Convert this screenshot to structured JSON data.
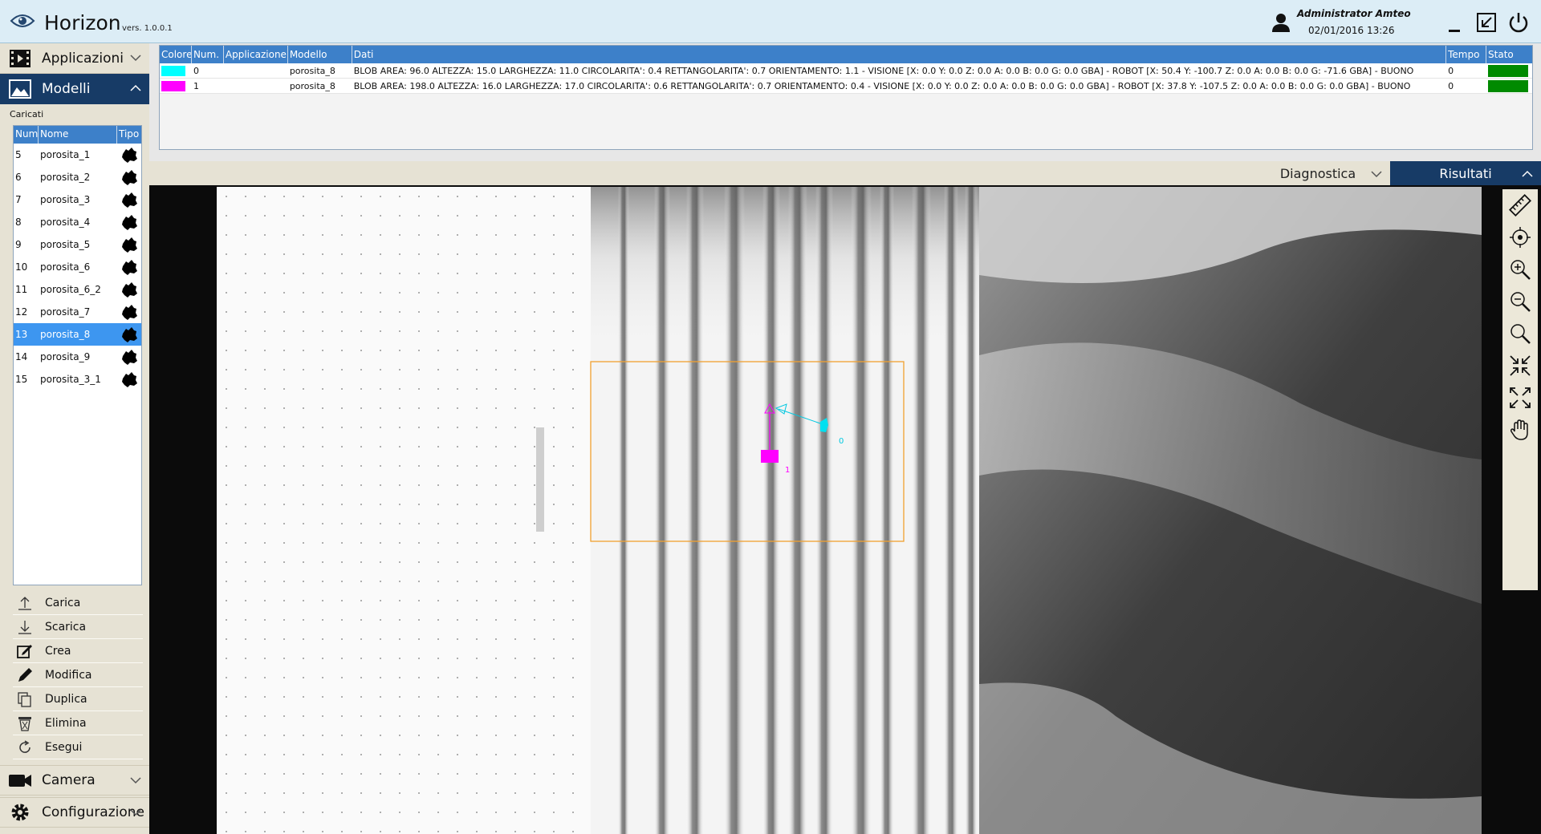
{
  "app": {
    "title": "Horizon",
    "version": "vers. 1.0.0.1"
  },
  "user": {
    "name": "Administrator Amteo",
    "datetime": "02/01/2016 13:26"
  },
  "sidebar": {
    "sections": {
      "applicazioni": "Applicazioni",
      "modelli": "Modelli",
      "camera": "Camera",
      "configurazione": "Configurazione"
    },
    "loaded_label": "Caricati",
    "list_headers": {
      "num": "Num",
      "name": "Nome",
      "type": "Tipo"
    },
    "models": [
      {
        "num": "5",
        "name": "porosita_1"
      },
      {
        "num": "6",
        "name": "porosita_2"
      },
      {
        "num": "7",
        "name": "porosita_3"
      },
      {
        "num": "8",
        "name": "porosita_4"
      },
      {
        "num": "9",
        "name": "porosita_5"
      },
      {
        "num": "10",
        "name": "porosita_6"
      },
      {
        "num": "11",
        "name": "porosita_6_2"
      },
      {
        "num": "12",
        "name": "porosita_7"
      },
      {
        "num": "13",
        "name": "porosita_8"
      },
      {
        "num": "14",
        "name": "porosita_9"
      },
      {
        "num": "15",
        "name": "porosita_3_1"
      }
    ],
    "selected_model": "porosita_8",
    "actions": {
      "carica": "Carica",
      "scarica": "Scarica",
      "crea": "Crea",
      "modifica": "Modifica",
      "duplica": "Duplica",
      "elimina": "Elimina",
      "esegui": "Esegui"
    }
  },
  "results": {
    "headers": {
      "colore": "Colore",
      "num": "Num.",
      "applicazione": "Applicazione",
      "modello": "Modello",
      "dati": "Dati",
      "tempo": "Tempo",
      "stato": "Stato"
    },
    "rows": [
      {
        "color": "#00ffff",
        "num": "0",
        "applicazione": "",
        "modello": "porosita_8",
        "dati": "BLOB AREA: 96.0 ALTEZZA: 15.0 LARGHEZZA: 11.0 CIRCOLARITA': 0.4 RETTANGOLARITA': 0.7 ORIENTAMENTO: 1.1 - VISIONE [X: 0.0 Y: 0.0 Z: 0.0 A: 0.0 B: 0.0 G: 0.0 GBA] - ROBOT [X: 50.4 Y: -100.7 Z: 0.0 A: 0.0 B: 0.0 G: -71.6 GBA] - BUONO",
        "tempo": "0",
        "stato_color": "#008a00"
      },
      {
        "color": "#ff00ff",
        "num": "1",
        "applicazione": "",
        "modello": "porosita_8",
        "dati": "BLOB AREA: 198.0 ALTEZZA: 16.0 LARGHEZZA: 17.0 CIRCOLARITA': 0.6 RETTANGOLARITA': 0.7 ORIENTAMENTO: 0.4 - VISIONE [X: 0.0 Y: 0.0 Z: 0.0 A: 0.0 B: 0.0 G: 0.0 GBA] - ROBOT [X: 37.8 Y: -107.5 Z: 0.0 A: 0.0 B: 0.0 G: 0.0 GBA] - BUONO",
        "tempo": "0",
        "stato_color": "#008a00"
      }
    ]
  },
  "tabs": {
    "diagnostica": "Diagnostica",
    "risultati": "Risultati",
    "active": "Risultati"
  },
  "overlay": {
    "blob_labels": [
      "0",
      "1"
    ]
  },
  "toolbar_icons": [
    "ruler-icon",
    "crosshair-icon",
    "zoom-in-icon",
    "zoom-out-icon",
    "zoom-icon",
    "fit-in-icon",
    "fit-out-icon",
    "pan-hand-icon"
  ],
  "colors": {
    "accent": "#173b66",
    "header_blue": "#3d80c9",
    "selected": "#3d96f0",
    "roi": "#f0a030",
    "ok": "#008a00"
  }
}
